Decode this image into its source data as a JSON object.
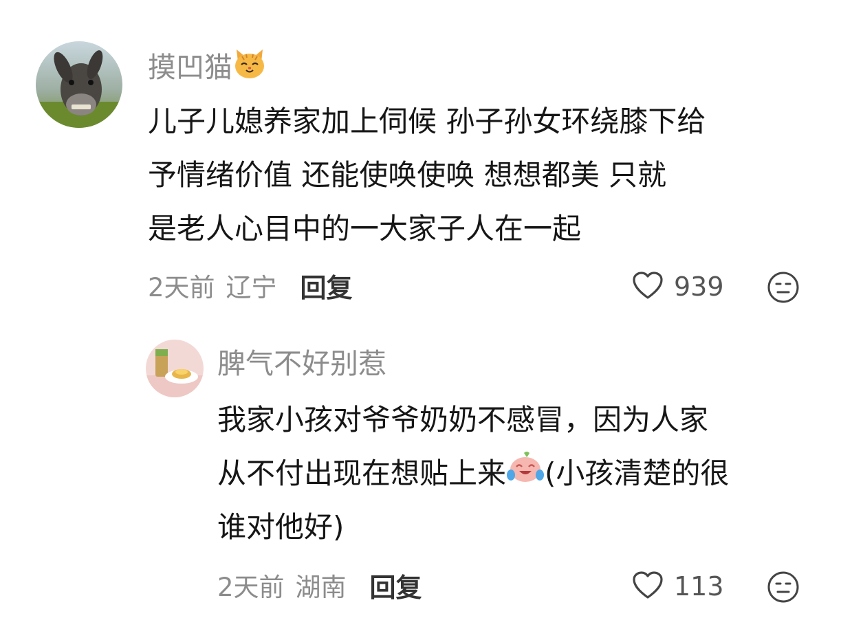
{
  "comments": [
    {
      "username": "摸凹猫",
      "username_emoji": "cat-face-emoji",
      "lines": [
        "儿子儿媳养家加上伺候  孙子孙女环绕膝下给",
        "予情绪价值   还能使唤使唤   想想都美  只就",
        "是老人心目中的一大家子人在一起"
      ],
      "time": "2天前",
      "location": "辽宁",
      "reply_label": "回复",
      "like_count": "939",
      "like_icon": "heart-outline-icon",
      "reaction_icon": "neutral-face-icon"
    },
    {
      "username": "脾气不好别惹",
      "lines_1": "我家小孩对爷爷奶奶不感冒，因为人家",
      "line_2_before": "从不付出现在想贴上来",
      "line_2_emoji": "laughing-tears-emoji",
      "line_2_after": "(小孩清楚的很",
      "lines_3": "谁对他好)",
      "time": "2天前",
      "location": "湖南",
      "reply_label": "回复",
      "like_count": "113",
      "like_icon": "heart-outline-icon",
      "reaction_icon": "neutral-face-icon"
    }
  ],
  "colors": {
    "username": "#8c8c8c",
    "body_text": "#161616",
    "meta": "#8c8c8c",
    "reply": "#333333"
  }
}
